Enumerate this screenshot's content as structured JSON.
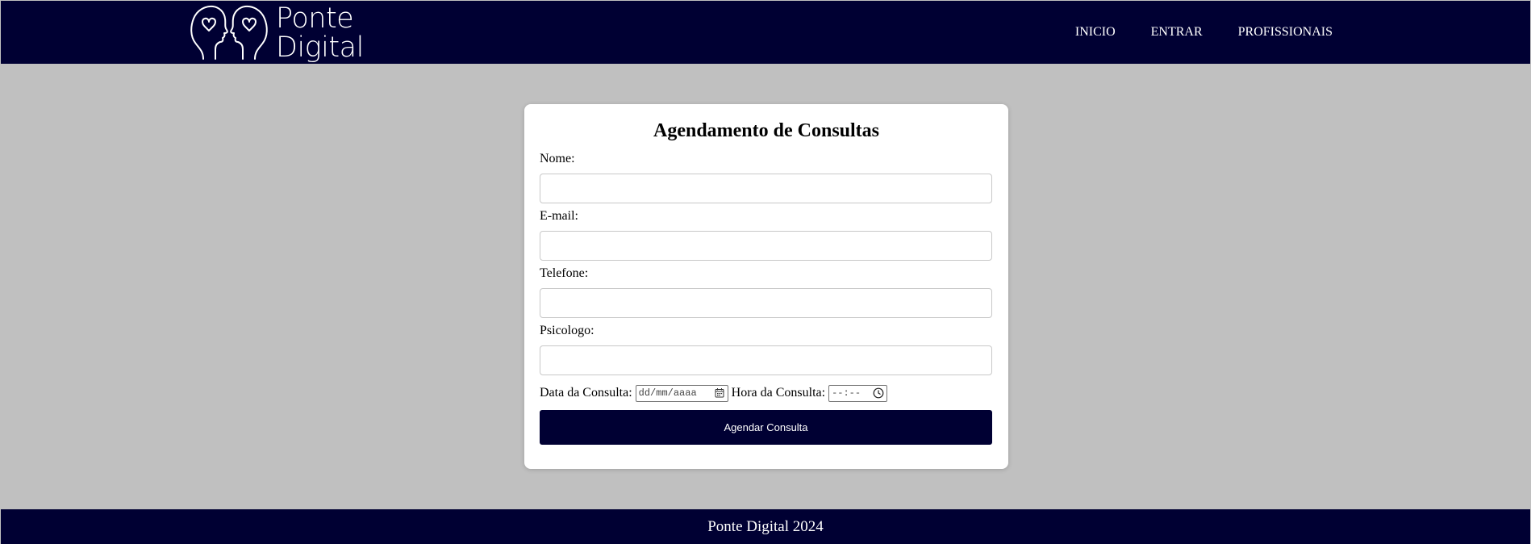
{
  "header": {
    "logo_line1": "Ponte",
    "logo_line2": "Digital",
    "nav": [
      "INICIO",
      "ENTRAR",
      "PROFISSIONAIS"
    ]
  },
  "form": {
    "title": "Agendamento de Consultas",
    "fields": [
      {
        "label": "Nome:",
        "value": ""
      },
      {
        "label": "E-mail:",
        "value": ""
      },
      {
        "label": "Telefone:",
        "value": ""
      },
      {
        "label": "Psicologo:",
        "value": ""
      }
    ],
    "date_label": "Data da Consulta:",
    "date_placeholder": "dd/mm/aaaa",
    "time_label": "Hora da Consulta:",
    "time_placeholder": "--:--",
    "submit_label": "Agendar Consulta"
  },
  "footer": {
    "text": "Ponte Digital 2024"
  },
  "colors": {
    "brand_navy": "#000033",
    "page_background": "#c0c0c0",
    "card_background": "#ffffff"
  },
  "icons": [
    "logo-faces-icon",
    "calendar-icon",
    "clock-icon"
  ]
}
